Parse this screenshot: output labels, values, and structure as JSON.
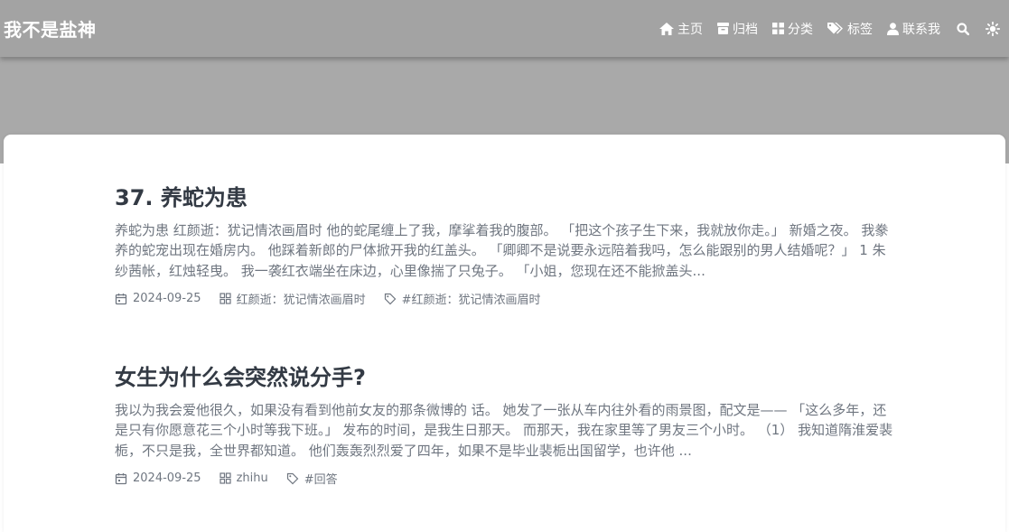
{
  "site": {
    "brand": "我不是盐神"
  },
  "nav": {
    "items": [
      {
        "label": "主页",
        "icon": "home-icon"
      },
      {
        "label": "归档",
        "icon": "archive-icon"
      },
      {
        "label": "分类",
        "icon": "grid-icon"
      },
      {
        "label": "标签",
        "icon": "tags-icon"
      },
      {
        "label": "联系我",
        "icon": "user-icon"
      }
    ],
    "search_icon": "search-icon",
    "theme_icon": "sun-icon"
  },
  "posts": [
    {
      "title": "37. 养蛇为患",
      "excerpt": "养蛇为患 红颜逝：犹记情浓画眉时 他的蛇尾缠上了我，摩挲着我的腹部。 「把这个孩子生下来，我就放你走。」 新婚之夜。 我豢养的蛇宠出现在婚房内。 他踩着新郎的尸体掀开我的红盖头。 「卿卿不是说要永远陪着我吗，怎么能跟别的男人结婚呢？」 1 朱纱茜帐，红烛轻曳。 我一袭红衣端坐在床边，心里像揣了只兔子。 「小姐，您现在还不能掀盖头...",
      "date": "2024-09-25",
      "category": "红颜逝：犹记情浓画眉时",
      "tag": "#红颜逝：犹记情浓画眉时"
    },
    {
      "title": "女生为什么会突然说分手?",
      "excerpt": "我以为我会爱他很久，如果没有看到他前女友的那条微博的 话。 她发了一张从车内往外看的雨景图，配文是—— 「这么多年，还是只有你愿意花三个小时等我下班。」 发布的时间，是我生日那天。 而那天，我在家里等了男友三个小时。 （1） 我知道隋淮爱裴栀，不只是我，全世界都知道。 他们轰轰烈烈爱了四年，如果不是毕业裴栀出国留学，也许他 ...",
      "date": "2024-09-25",
      "category": "zhihu",
      "tag": "#回答"
    }
  ],
  "colors": {
    "navbar": "#a3a3a3",
    "banner": "#a9a9a9",
    "title_text": "#333a44",
    "meta_text": "#6f7680"
  }
}
